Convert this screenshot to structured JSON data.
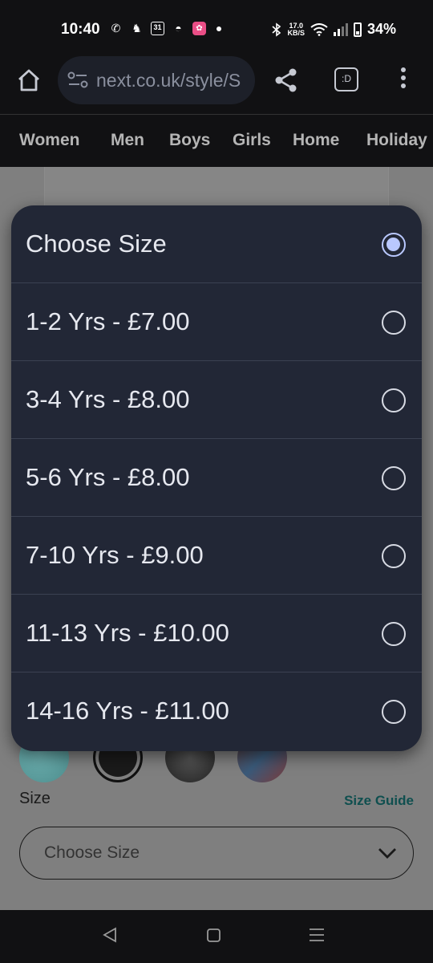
{
  "status_bar": {
    "time": "10:40",
    "calendar_day": "31",
    "net_speed_value": "17.0",
    "net_speed_unit": "KB/S",
    "battery": "34%"
  },
  "browser": {
    "url": "next.co.uk/style/S",
    "tabs_label": ":D"
  },
  "categories": [
    "Women",
    "Men",
    "Boys",
    "Girls",
    "Home",
    "Holiday"
  ],
  "dialog": {
    "options": [
      {
        "label": "Choose Size",
        "selected": true
      },
      {
        "label": "1-2 Yrs - £7.00",
        "selected": false
      },
      {
        "label": "3-4 Yrs - £8.00",
        "selected": false
      },
      {
        "label": "5-6 Yrs - £8.00",
        "selected": false
      },
      {
        "label": "7-10 Yrs - £9.00",
        "selected": false
      },
      {
        "label": "11-13 Yrs - £10.00",
        "selected": false
      },
      {
        "label": "14-16 Yrs - £11.00",
        "selected": false
      }
    ]
  },
  "product": {
    "size_label": "Size",
    "size_guide": "Size Guide",
    "size_select_value": "Choose Size"
  },
  "colors": {
    "dialog_bg": "#222736",
    "radio_selected": "#b9c8ff",
    "size_guide": "#0f4f4f"
  }
}
